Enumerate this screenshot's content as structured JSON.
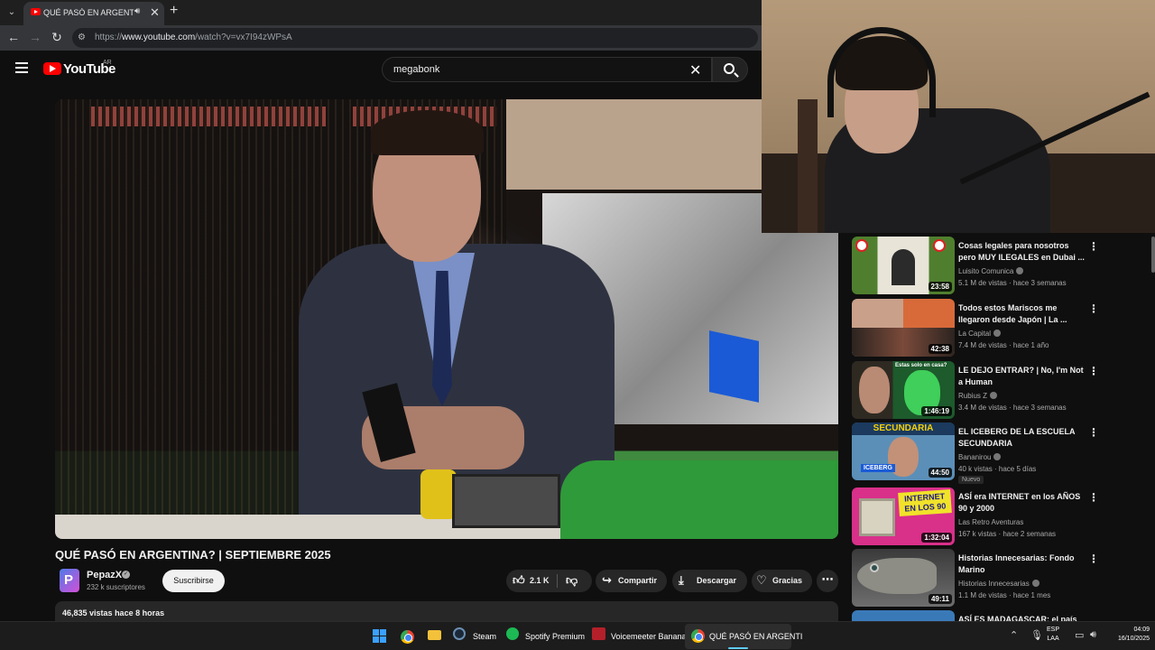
{
  "browser": {
    "tab_title": "QUÉ PASÓ EN ARGENTINA? | SEPTIEMBRE 2025",
    "tab_title_visible": "QUÉ PASÓ EN ARGENTINA",
    "url_prefix": "https://",
    "url_domain": "www.youtube.com",
    "url_path": "/watch?v=vx7I94zWPsA"
  },
  "youtube": {
    "logo_text": "YouTube",
    "country_code": "AR",
    "search_value": "megabonk",
    "brand_color": "#ff0000"
  },
  "video": {
    "title": "QUÉ PASÓ EN ARGENTINA? | SEPTIEMBRE 2025",
    "channel_name": "PepazX",
    "subscribers": "232 k suscriptores",
    "subscribe_label": "Suscribirse",
    "likes": "2.1 K",
    "share_label": "Compartir",
    "download_label": "Descargar",
    "thanks_label": "Gracias",
    "views": "46,835 vistas",
    "age": "hace 8 horas"
  },
  "recommendations": [
    {
      "title": "Cosas legales para nosotros pero MUY ILEGALES en Dubai ...",
      "channel": "Luisito Comunica",
      "verified": true,
      "meta": "5.1 M de vistas · hace 3 semanas",
      "duration": "23:58",
      "badge": ""
    },
    {
      "title": "Todos estos Mariscos me llegaron desde Japón | La ...",
      "channel": "La Capital",
      "verified": true,
      "meta": "7.4 M de vistas · hace 1 año",
      "duration": "42:38",
      "badge": ""
    },
    {
      "title": "LE DEJO ENTRAR? | No, I'm Not a Human",
      "channel": "Rubius Z",
      "verified": true,
      "meta": "3.4 M de vistas · hace 3 semanas",
      "duration": "1:46:19",
      "badge": ""
    },
    {
      "title": "EL ICEBERG DE LA ESCUELA SECUNDARIA",
      "channel": "Bananirou",
      "verified": true,
      "meta": "40 k vistas · hace 5 días",
      "duration": "44:50",
      "badge": "Nuevo"
    },
    {
      "title": "ASÍ era INTERNET en los AÑOS 90 y 2000",
      "channel": "Las Retro Aventuras",
      "verified": false,
      "meta": "167 k vistas · hace 2 semanas",
      "duration": "1:32:04",
      "badge": ""
    },
    {
      "title": "Historias Innecesarias: Fondo Marino",
      "channel": "Historias Innecesarias",
      "verified": true,
      "meta": "1.1 M de vistas · hace 1 mes",
      "duration": "49:11",
      "badge": ""
    },
    {
      "title": "ASÍ ES MADAGASCAR: el país",
      "channel": "",
      "verified": false,
      "meta": "",
      "duration": "",
      "badge": ""
    }
  ],
  "thumb_text": {
    "t3": "Estas solo en casa?",
    "t4": "SECUNDARIA",
    "t4b": "ICEBERG",
    "t5": "INTERNET EN LOS 90"
  },
  "taskbar": {
    "steam": "Steam",
    "spotify": "Spotify Premium",
    "voicemeeter": "Voicemeeter Banana",
    "chrome_window": "QUÉ PASÓ EN ARGENTI",
    "lang_1": "ESP",
    "lang_2": "LAA",
    "time": "04:09",
    "date": "16/10/2025"
  }
}
